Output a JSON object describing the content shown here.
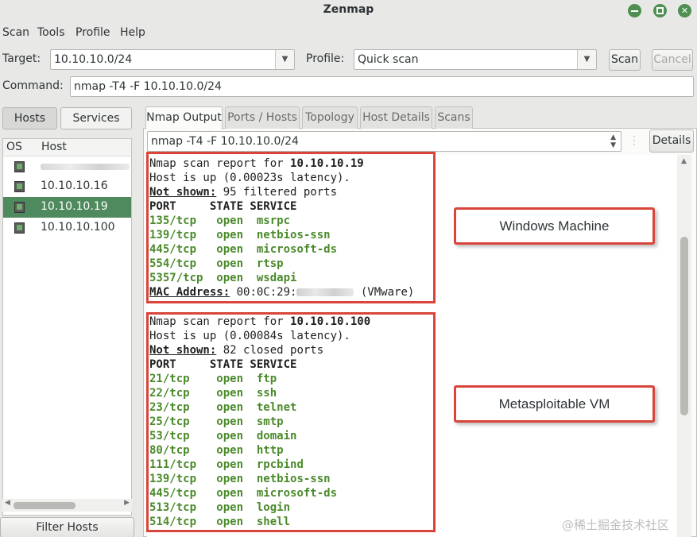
{
  "window": {
    "title": "Zenmap"
  },
  "menu": [
    "Scan",
    "Tools",
    "Profile",
    "Help"
  ],
  "toolbar": {
    "target_label": "Target:",
    "target_value": "10.10.10.0/24",
    "profile_label": "Profile:",
    "profile_value": "Quick scan",
    "scan_button": "Scan",
    "cancel_button": "Cancel",
    "command_label": "Command:",
    "command_value": "nmap -T4 -F 10.10.10.0/24"
  },
  "left_panel": {
    "hosts_button": "Hosts",
    "services_button": "Services",
    "col_os": "OS",
    "col_host": "Host",
    "hosts": [
      {
        "address": "",
        "redacted": true,
        "selected": false
      },
      {
        "address": "10.10.10.16",
        "selected": false
      },
      {
        "address": "10.10.10.19",
        "selected": true
      },
      {
        "address": "10.10.10.100",
        "selected": false
      }
    ],
    "filter_button": "Filter Hosts"
  },
  "tabs": [
    "Nmap Output",
    "Ports / Hosts",
    "Topology",
    "Host Details",
    "Scans"
  ],
  "active_tab": "Nmap Output",
  "output_selector": {
    "value": "nmap -T4 -F 10.10.10.0/24",
    "details_button": "Details"
  },
  "report1": {
    "header_prefix": "Nmap scan report for ",
    "ip": "10.10.10.19",
    "host_up": "Host is up (0.00023s latency).",
    "not_shown_label": "Not shown:",
    "not_shown_text": " 95 filtered ports",
    "columns": "PORT     STATE SERVICE",
    "ports": [
      {
        "port": "135/tcp ",
        "state": "open",
        "service": "msrpc"
      },
      {
        "port": "139/tcp ",
        "state": "open",
        "service": "netbios-ssn"
      },
      {
        "port": "445/tcp ",
        "state": "open",
        "service": "microsoft-ds"
      },
      {
        "port": "554/tcp ",
        "state": "open",
        "service": "rtsp"
      },
      {
        "port": "5357/tcp",
        "state": "open",
        "service": "wsdapi"
      }
    ],
    "mac_label": "MAC Address:",
    "mac_prefix": " 00:0C:29:",
    "mac_vendor": " (VMware)",
    "callout": "Windows Machine"
  },
  "report2": {
    "header_prefix": "Nmap scan report for ",
    "ip": "10.10.10.100",
    "host_up": "Host is up (0.00084s latency).",
    "not_shown_label": "Not shown:",
    "not_shown_text": " 82 closed ports",
    "columns": "PORT     STATE SERVICE",
    "ports": [
      {
        "port": "21/tcp  ",
        "state": "open",
        "service": "ftp"
      },
      {
        "port": "22/tcp  ",
        "state": "open",
        "service": "ssh"
      },
      {
        "port": "23/tcp  ",
        "state": "open",
        "service": "telnet"
      },
      {
        "port": "25/tcp  ",
        "state": "open",
        "service": "smtp"
      },
      {
        "port": "53/tcp  ",
        "state": "open",
        "service": "domain"
      },
      {
        "port": "80/tcp  ",
        "state": "open",
        "service": "http"
      },
      {
        "port": "111/tcp ",
        "state": "open",
        "service": "rpcbind"
      },
      {
        "port": "139/tcp ",
        "state": "open",
        "service": "netbios-ssn"
      },
      {
        "port": "445/tcp ",
        "state": "open",
        "service": "microsoft-ds"
      },
      {
        "port": "513/tcp ",
        "state": "open",
        "service": "login"
      },
      {
        "port": "514/tcp ",
        "state": "open",
        "service": "shell"
      }
    ],
    "callout": "Metasploitable VM"
  },
  "watermark": "@稀土掘金技术社区",
  "colors": {
    "selection": "#4e8a5d",
    "port_text": "#4a8a2a",
    "highlight_box": "#d9453b"
  }
}
